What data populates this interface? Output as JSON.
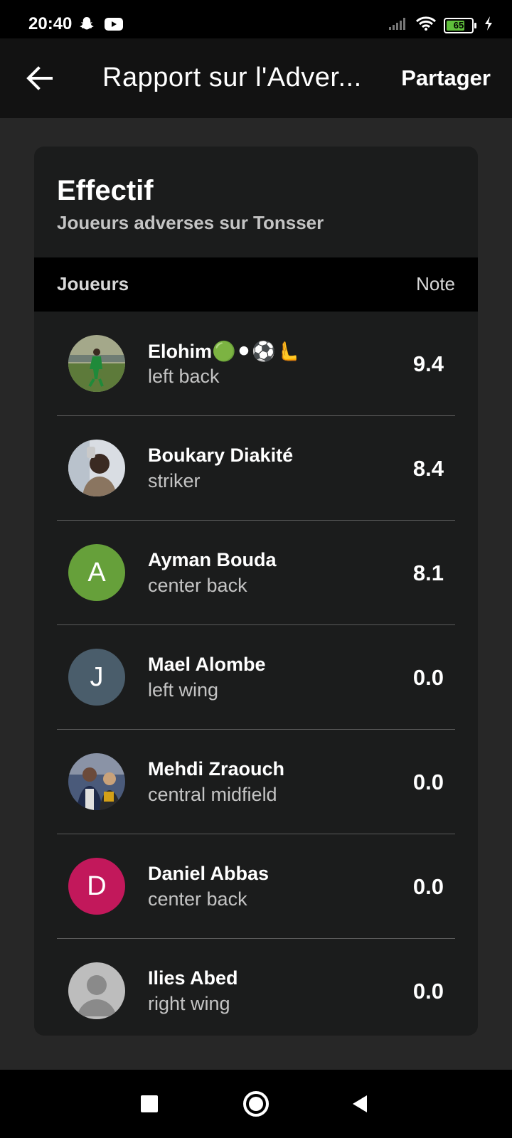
{
  "status_bar": {
    "time": "20:40",
    "battery_level": "65",
    "icons": [
      "snapchat-icon",
      "youtube-icon",
      "signal-icon",
      "wifi-icon",
      "battery-icon",
      "charging-bolt-icon"
    ]
  },
  "app_bar": {
    "title": "Rapport sur l'Adver...",
    "share_label": "Partager",
    "back_icon": "arrow-left-icon"
  },
  "squad": {
    "title": "Effectif",
    "subtitle": "Joueurs adverses sur Tonsser",
    "col_players": "Joueurs",
    "col_rating": "Note",
    "players": [
      {
        "name": "Elohim🟢⚫⚽🫷",
        "position": "left back",
        "rating": "9.4",
        "avatar_type": "photo",
        "avatar_letter": "",
        "avatar_color": "#5d7a3a"
      },
      {
        "name": "Boukary Diakité",
        "position": "striker",
        "rating": "8.4",
        "avatar_type": "photo",
        "avatar_letter": "",
        "avatar_color": "#8a7560"
      },
      {
        "name": "Ayman Bouda",
        "position": "center back",
        "rating": "8.1",
        "avatar_type": "letter",
        "avatar_letter": "A",
        "avatar_color": "#66a03a"
      },
      {
        "name": "Mael Alombe",
        "position": "left wing",
        "rating": "0.0",
        "avatar_type": "letter",
        "avatar_letter": "J",
        "avatar_color": "#4a5d6b"
      },
      {
        "name": "Mehdi Zraouch",
        "position": "central midfield",
        "rating": "0.0",
        "avatar_type": "photo",
        "avatar_letter": "",
        "avatar_color": "#2d3b5a"
      },
      {
        "name": "Daniel Abbas",
        "position": "center back",
        "rating": "0.0",
        "avatar_type": "letter",
        "avatar_letter": "D",
        "avatar_color": "#c2185b"
      },
      {
        "name": "Ilies Abed",
        "position": "right wing",
        "rating": "0.0",
        "avatar_type": "default",
        "avatar_letter": "",
        "avatar_color": "#bdbdbd"
      }
    ]
  },
  "nav_bar": {
    "icons": [
      "recent-apps-icon",
      "home-icon",
      "back-triangle-icon"
    ]
  }
}
